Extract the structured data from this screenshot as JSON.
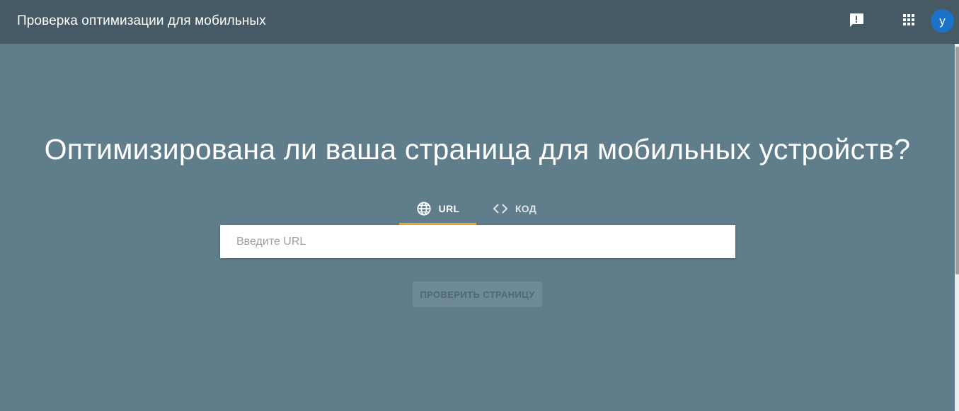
{
  "header": {
    "title": "Проверка оптимизации для мобильных",
    "feedback_icon": "feedback-icon",
    "apps_icon": "apps-grid-icon",
    "avatar_letter": "у"
  },
  "main": {
    "headline": "Оптимизирована ли ваша страница для мобильных устройств?",
    "tabs": [
      {
        "label": "URL",
        "icon": "globe-icon",
        "selected": true
      },
      {
        "label": "КОД",
        "icon": "code-icon",
        "selected": false
      }
    ],
    "url_input": {
      "value": "",
      "placeholder": "Введите URL"
    },
    "check_button": {
      "label": "ПРОВЕРИТЬ СТРАНИЦУ",
      "enabled": false
    }
  },
  "colors": {
    "background": "#607d8b",
    "header": "#455a64",
    "tab_indicator": "#f4a928",
    "avatar": "#1a73c8"
  }
}
